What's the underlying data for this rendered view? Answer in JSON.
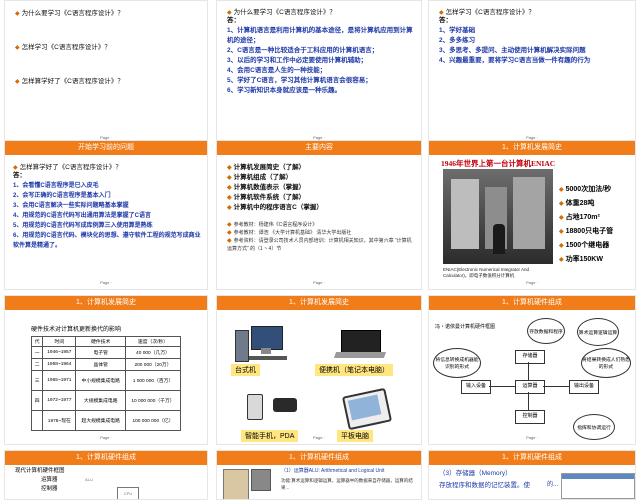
{
  "slides": {
    "s1": {
      "items": [
        "为什么要学习《C语言程序设计》？",
        "怎样学习《C语言程序设计》？",
        "怎样算学好了《C语言程序设计》？"
      ],
      "page": "Page ·"
    },
    "s2": {
      "question": "为什么要学习《C语言程序设计》？",
      "answer_label": "答：",
      "lines": [
        "1、计算机语言是利用计算机的基本途径，是将计算机应用到计算机的途径；",
        "2、C语言是一种比较适合于工科应用的计算机语言；",
        "3、以后的学习和工作中必定要使用计算机辅助；",
        "4、会用C语言是人生的一种技能；",
        "5、学好了C语言，学习其他计算机语言会很容易；",
        "6、学习新知识本身就应该是一种乐趣。"
      ],
      "page": "Page ·"
    },
    "s3": {
      "question": "怎样学习《C语言程序设计》？",
      "answer_label": "答：",
      "lines": [
        "1、学好基础",
        "2、多多练习",
        "3、多思考、多提问、主动使用计算机解决实际问题",
        "4、兴趣最重要，要将学习C语言当做一件有趣的行为"
      ],
      "page": "Page ·"
    },
    "s4": {
      "header": "开始学习前的问题",
      "question": "怎样算学好了《C语言程序设计》？",
      "answer_label": "答：",
      "lines": [
        "1、会看懂C语言程序是已入皮毛",
        "2、会写正确的C语言程序是基本入门",
        "3、会用C语言解决一些实际问题略基本掌握",
        "4、用规范的C语言代码写出通用算法是掌握了C语言",
        "5、用规范的C语言代码写成库例算三入使用算是熟练",
        "6、用规范的C语言代码、模块化的思想、遵守软件工程的规范写成商业软件算是精通了。"
      ],
      "page": "Page ·"
    },
    "s5": {
      "header": "主要内容",
      "items": [
        "计算机发展简史（了解）",
        "计算机组成（了解）",
        "计算机数值表示（掌握）",
        "计算机软件系统（了解）",
        "计算机中的程序语言C（掌握）"
      ],
      "refs": [
        "参考教材：杨建伟《C语言程序设计》",
        "参考教材：谭浩 《大学计算机基础》 清华大学出版社",
        "参考资料：请登录公司技术人员内部培训：计算机相关知识，其中第六章 “计算机运算方式” 的（1 ~ 4）节"
      ],
      "page": "Page ·"
    },
    "s6": {
      "header": "1、计算机发展简史",
      "title": "1946年世界上第一台计算机ENIAC",
      "specs": [
        "5000次加法/秒",
        "体重28吨",
        "占地170m²",
        "18800只电子管",
        "1500个继电器",
        "功率150KW"
      ],
      "caption": "ENIAC(Electronic Numerical Integrator And Calculator)，即电子数值积分计算机",
      "page": "Page ·"
    },
    "s7": {
      "header": "1、计算机发展简史",
      "subtitle": "硬件技术对计算机更新换代的影响",
      "columns": [
        "代",
        "时间",
        "硬件技术",
        "速度（次/秒）"
      ],
      "rows": [
        [
          "一",
          "1946~1957",
          "电子管",
          "40 000（几万）"
        ],
        [
          "二",
          "1958~1964",
          "晶体管",
          "200 000（20万）"
        ],
        [
          "三",
          "1965~1971",
          "中小规模集成电路",
          "1 000 000（百万）"
        ],
        [
          "四",
          "1972~1977",
          "大规模集成电路",
          "10 000 000（千万）"
        ],
        [
          "",
          "1978~现在",
          "超大规模集成电路",
          "100 000 000（亿）"
        ]
      ],
      "page": "Page ·"
    },
    "s8": {
      "header": "1、计算机发展简史",
      "captions": [
        "台式机",
        "便携机（笔记本电脑）",
        "智能手机，PDA",
        "平板电脑"
      ],
      "page": "Page ·"
    },
    "s9": {
      "header": "1、计算机硬件组成",
      "title": "冯・诺依曼计算机硬件框图",
      "nodes": {
        "memory": "存储器",
        "input": "输入设备",
        "alu": "运算器",
        "output": "输出设备",
        "controller": "控制器"
      },
      "clouds": [
        "存放数据和程序",
        "算术运算逻辑运算",
        "将信息转换成机器能识别的形式",
        "将结果转换成人们熟悉的形式",
        "指挥和协调运行"
      ],
      "page": "Page ·"
    },
    "s10": {
      "header": "1、计算机硬件组成",
      "lines": [
        "现代计算机硬件框图",
        "运算器",
        "控制器"
      ],
      "labels": [
        "ALU",
        "CPU"
      ]
    },
    "s11": {
      "header": "1、计算机硬件组成",
      "title": "（1）运算器ALU: Arithmetical and Logical Unit",
      "text": "功能:算术运算和逻辑运算，运算器中的数据来自存储器，运算的结果..."
    },
    "s12": {
      "header": "1、计算机硬件组成",
      "title": "（3）存储器（Memory）",
      "text": "存放程序和数据的记忆装置。使",
      "tail": "的..."
    }
  },
  "colors": {
    "accent": "#f07d1a",
    "blue": "#1f3aa8",
    "bullet": "#d56c00"
  }
}
